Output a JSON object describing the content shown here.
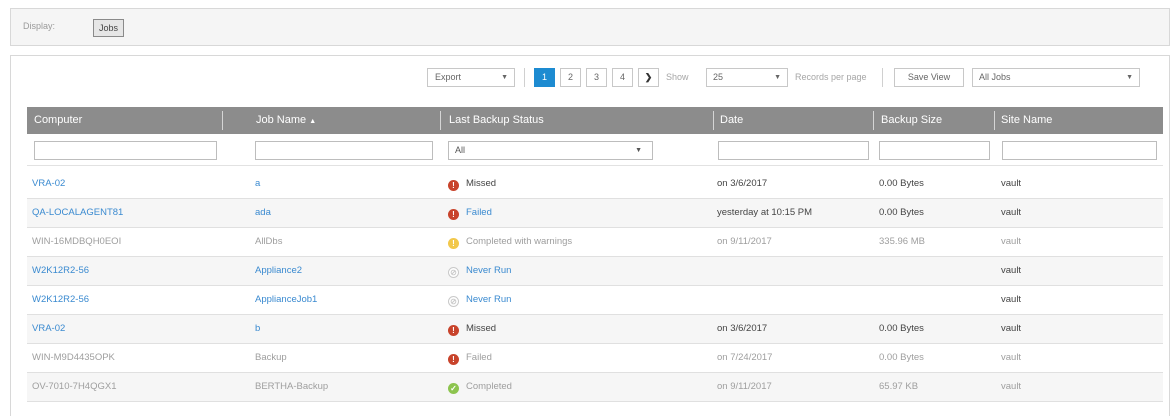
{
  "display": {
    "label": "Display:",
    "button": "Jobs"
  },
  "toolbar": {
    "export": "Export",
    "pages": [
      "1",
      "2",
      "3",
      "4"
    ],
    "next_icon": "chevron-right-icon",
    "show_label": "Show",
    "per_page": "25",
    "records_label": "Records per page",
    "save_view": "Save View",
    "view_select": "All Jobs"
  },
  "columns": [
    "Computer",
    "Job Name",
    "Last Backup Status",
    "Date",
    "Backup Size",
    "Site Name"
  ],
  "sort_indicator": "▲",
  "filters": {
    "status": "All"
  },
  "rows": [
    {
      "computer": "VRA-02",
      "job": "a",
      "status": "Missed",
      "date": "on 3/6/2017",
      "size": "0.00 Bytes",
      "site": "vault"
    },
    {
      "computer": "QA-LOCALAGENT81",
      "job": "ada",
      "status": "Failed",
      "date": "yesterday at 10:15 PM",
      "size": "0.00 Bytes",
      "site": "vault"
    },
    {
      "computer": "WIN-16MDBQH0EOI",
      "job": "AllDbs",
      "status": "Completed with warnings",
      "date": "on 9/11/2017",
      "size": "335.96 MB",
      "site": "vault"
    },
    {
      "computer": "W2K12R2-56",
      "job": "Appliance2",
      "status": "Never Run",
      "date": "",
      "size": "",
      "site": "vault"
    },
    {
      "computer": "W2K12R2-56",
      "job": "ApplianceJob1",
      "status": "Never Run",
      "date": "",
      "size": "",
      "site": "vault"
    },
    {
      "computer": "VRA-02",
      "job": "b",
      "status": "Missed",
      "date": "on 3/6/2017",
      "size": "0.00 Bytes",
      "site": "vault"
    },
    {
      "computer": "WIN-M9D4435OPK",
      "job": "Backup",
      "status": "Failed",
      "date": "on 7/24/2017",
      "size": "0.00 Bytes",
      "site": "vault"
    },
    {
      "computer": "OV-7010-7H4QGX1",
      "job": "BERTHA-Backup",
      "status": "Completed",
      "date": "on 9/11/2017",
      "size": "65.97 KB",
      "site": "vault"
    }
  ],
  "colors": {
    "accent": "#1d8bd1",
    "header": "#8c8c8c",
    "link": "#3a8ad0",
    "error": "#c8432b",
    "warning": "#f2c84b",
    "success": "#8dc44f"
  }
}
